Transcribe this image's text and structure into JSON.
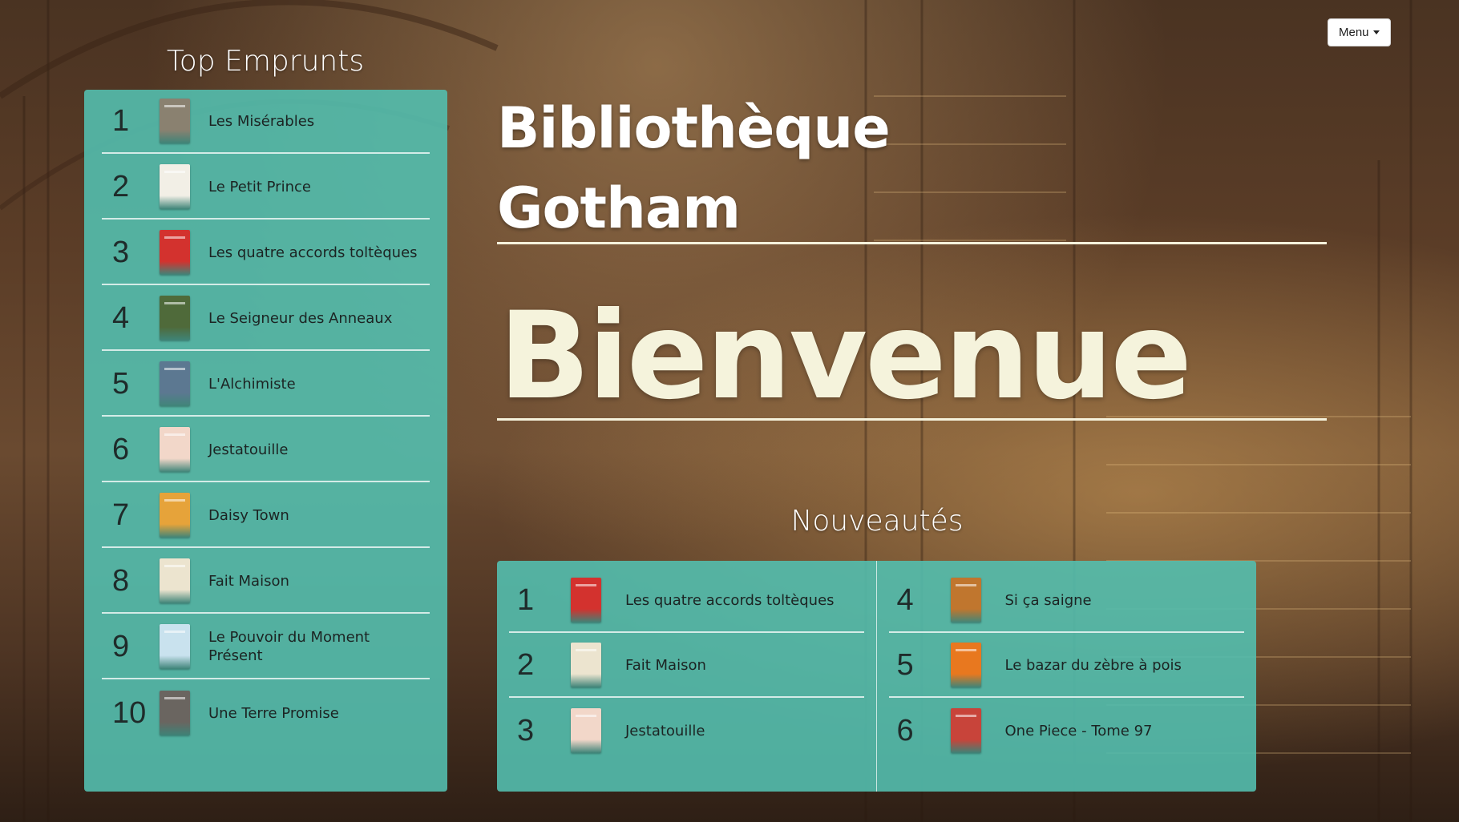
{
  "menu": {
    "label": "Menu",
    "icon": "caret-down-icon"
  },
  "header": {
    "title_line1": "Bibliothèque",
    "title_line2": "Gotham",
    "welcome": "Bienvenue"
  },
  "top_borrowed": {
    "title": "Top Emprunts",
    "items": [
      {
        "rank": "1",
        "title": "Les Misérables",
        "cover_color": "#8a8170"
      },
      {
        "rank": "2",
        "title": "Le Petit Prince",
        "cover_color": "#f2efe6"
      },
      {
        "rank": "3",
        "title": "Les quatre accords toltèques",
        "cover_color": "#d3322e"
      },
      {
        "rank": "4",
        "title": "Le Seigneur des Anneaux",
        "cover_color": "#4f6a3a"
      },
      {
        "rank": "5",
        "title": "L'Alchimiste",
        "cover_color": "#5c7891"
      },
      {
        "rank": "6",
        "title": "Jestatouille",
        "cover_color": "#f2d7c9"
      },
      {
        "rank": "7",
        "title": "Daisy Town",
        "cover_color": "#e6a33a"
      },
      {
        "rank": "8",
        "title": "Fait Maison",
        "cover_color": "#ece4cf"
      },
      {
        "rank": "9",
        "title": "Le Pouvoir du Moment Présent",
        "cover_color": "#c9e2ee"
      },
      {
        "rank": "10",
        "title": "Une Terre Promise",
        "cover_color": "#6a6560"
      }
    ]
  },
  "new_arrivals": {
    "title": "Nouveautés",
    "left": [
      {
        "rank": "1",
        "title": "Les quatre accords toltèques",
        "cover_color": "#d3322e"
      },
      {
        "rank": "2",
        "title": "Fait Maison",
        "cover_color": "#ece4cf"
      },
      {
        "rank": "3",
        "title": "Jestatouille",
        "cover_color": "#f2d7c9"
      }
    ],
    "right": [
      {
        "rank": "4",
        "title": "Si ça saigne",
        "cover_color": "#c0762e"
      },
      {
        "rank": "5",
        "title": "Le bazar du zèbre à pois",
        "cover_color": "#e8781f"
      },
      {
        "rank": "6",
        "title": "One Piece - Tome 97",
        "cover_color": "#c8443a"
      }
    ]
  }
}
